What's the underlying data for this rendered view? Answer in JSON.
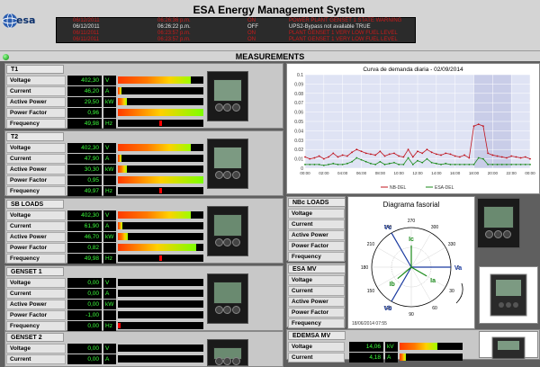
{
  "header": {
    "logo_text": "esa",
    "title": "ESA Energy Management System",
    "alarms": [
      {
        "date": "06/12/2011",
        "time": "06:26:36 p.m.",
        "state": "ON",
        "message": "POWER PLANT GENSET 1 STATE WARNING",
        "color": "#cc1a1a"
      },
      {
        "date": "06/12/2011",
        "time": "06:26:22 p.m.",
        "state": "OFF",
        "message": "UPS2-Bypass not available TRUE",
        "color": "#e8e8e8"
      },
      {
        "date": "06/11/2011",
        "time": "06:23:57 p.m.",
        "state": "ON",
        "message": "PLANT GENSET 1 VERY LOW FUEL LEVEL",
        "color": "#cc1a1a"
      },
      {
        "date": "06/11/2011",
        "time": "06:23:57 p.m.",
        "state": "ON",
        "message": "PLANT GENSET 1 VERY LOW FUEL LEVEL",
        "color": "#cc1a1a"
      }
    ]
  },
  "measurements_title": "MEASUREMENTS",
  "left_panels": [
    {
      "title": "T1",
      "rows": [
        {
          "label": "Voltage",
          "value": "402,30",
          "unit": "V",
          "level": 0.85,
          "marker": null
        },
        {
          "label": "Current",
          "value": "46,20",
          "unit": "A",
          "level": 0.04,
          "marker": null
        },
        {
          "label": "Active Power",
          "value": "29,50",
          "unit": "kW",
          "level": 0.1,
          "marker": null
        },
        {
          "label": "Power Factor",
          "value": "0,96",
          "unit": "",
          "level": 1.0,
          "marker": null
        },
        {
          "label": "Frequency",
          "value": "49,98",
          "unit": "Hz",
          "level": 0,
          "marker": 0.5
        }
      ]
    },
    {
      "title": "T2",
      "rows": [
        {
          "label": "Voltage",
          "value": "402,30",
          "unit": "V",
          "level": 0.85,
          "marker": null
        },
        {
          "label": "Current",
          "value": "47,90",
          "unit": "A",
          "level": 0.04,
          "marker": null
        },
        {
          "label": "Active Power",
          "value": "30,30",
          "unit": "kW",
          "level": 0.1,
          "marker": null
        },
        {
          "label": "Power Factor",
          "value": "0,95",
          "unit": "",
          "level": 1.0,
          "marker": null
        },
        {
          "label": "Frequency",
          "value": "49,97",
          "unit": "Hz",
          "level": 0,
          "marker": 0.5
        }
      ]
    },
    {
      "title": "SB LOADS",
      "rows": [
        {
          "label": "Voltage",
          "value": "402,30",
          "unit": "V",
          "level": 0.85,
          "marker": null
        },
        {
          "label": "Current",
          "value": "61,90",
          "unit": "A",
          "level": 0.05,
          "marker": null
        },
        {
          "label": "Active Power",
          "value": "46,70",
          "unit": "kW",
          "level": 0.12,
          "marker": null
        },
        {
          "label": "Power Factor",
          "value": "0,82",
          "unit": "",
          "level": 0.92,
          "marker": null
        },
        {
          "label": "Frequency",
          "value": "49,98",
          "unit": "Hz",
          "level": 0,
          "marker": 0.5
        }
      ]
    },
    {
      "title": "GENSET 1",
      "rows": [
        {
          "label": "Voltage",
          "value": "0,00",
          "unit": "V",
          "level": 0,
          "marker": null
        },
        {
          "label": "Current",
          "value": "0,00",
          "unit": "A",
          "level": 0,
          "marker": null
        },
        {
          "label": "Active Power",
          "value": "0,00",
          "unit": "kW",
          "level": 0,
          "marker": null
        },
        {
          "label": "Power Factor",
          "value": "-1,00",
          "unit": "",
          "level": 0,
          "marker": null
        },
        {
          "label": "Frequency",
          "value": "0,00",
          "unit": "Hz",
          "level": 0,
          "marker": 0.0
        }
      ]
    },
    {
      "title": "GENSET 2",
      "rows": [
        {
          "label": "Voltage",
          "value": "0,00",
          "unit": "V",
          "level": 0,
          "marker": null
        },
        {
          "label": "Current",
          "value": "0,00",
          "unit": "A",
          "level": 0,
          "marker": null
        }
      ]
    }
  ],
  "right_panels": [
    {
      "title": "NBc LOADS",
      "rows": [
        {
          "label": "Voltage"
        },
        {
          "label": "Current"
        },
        {
          "label": "Active Power"
        },
        {
          "label": "Power Factor"
        },
        {
          "label": "Frequency"
        }
      ]
    },
    {
      "title": "ESA MV",
      "rows": [
        {
          "label": "Voltage"
        },
        {
          "label": "Current"
        },
        {
          "label": "Active Power"
        },
        {
          "label": "Power Factor"
        },
        {
          "label": "Frequency"
        }
      ]
    },
    {
      "title": "EDEMSA MV",
      "rows": [
        {
          "label": "Voltage",
          "value": "14,06",
          "unit": "kV",
          "level": 0.6
        },
        {
          "label": "Current",
          "value": "4,18",
          "unit": "A",
          "level": 0.1
        }
      ]
    }
  ],
  "colors": {
    "led_green": "#3cff3c",
    "alarm_red": "#cc1a1a",
    "panel_bg": "#c8c8c8"
  },
  "chart_data": {
    "type": "line",
    "title": "Curva de demanda diaria - 02/09/2014",
    "x": [
      "00:00",
      "02:00",
      "04:00",
      "06:00",
      "08:00",
      "10:00",
      "12:00",
      "14:00",
      "16:00",
      "18:00",
      "20:00",
      "22:00",
      "00:00"
    ],
    "ytick_labels": [
      "0",
      "0.01",
      "0.02",
      "0.03",
      "0.04",
      "0.05",
      "0.06",
      "0.07",
      "0.08",
      "0.09",
      "0.1"
    ],
    "ylim": [
      0,
      0.1
    ],
    "series": [
      {
        "name": "NB-DEL",
        "color": "#c0141e",
        "values": [
          0.012,
          0.01,
          0.011,
          0.013,
          0.01,
          0.012,
          0.016,
          0.012,
          0.014,
          0.013,
          0.017,
          0.02,
          0.018,
          0.016,
          0.015,
          0.014,
          0.018,
          0.013,
          0.015,
          0.016,
          0.013,
          0.012,
          0.02,
          0.012,
          0.018,
          0.016,
          0.02,
          0.017,
          0.015,
          0.014,
          0.016,
          0.015,
          0.013,
          0.012,
          0.014,
          0.011,
          0.045,
          0.047,
          0.045,
          0.016,
          0.014,
          0.013,
          0.012,
          0.011,
          0.013,
          0.012,
          0.011,
          0.012,
          0.01
        ]
      },
      {
        "name": "ESA-DEL",
        "color": "#1a8a1a",
        "values": [
          0.004,
          0.004,
          0.004,
          0.004,
          0.003,
          0.004,
          0.005,
          0.004,
          0.004,
          0.005,
          0.007,
          0.011,
          0.009,
          0.007,
          0.005,
          0.004,
          0.007,
          0.004,
          0.005,
          0.006,
          0.004,
          0.004,
          0.011,
          0.004,
          0.008,
          0.006,
          0.01,
          0.006,
          0.005,
          0.004,
          0.005,
          0.004,
          0.004,
          0.004,
          0.004,
          0.004,
          0.004,
          0.011,
          0.01,
          0.004,
          0.004,
          0.004,
          0.004,
          0.004,
          0.004,
          0.004,
          0.004,
          0.004,
          0.004
        ]
      }
    ],
    "legend": [
      "NB-DEL",
      "ESA-DEL"
    ],
    "grid": true,
    "legend_position": "bottom"
  },
  "phasor": {
    "title": "Diagrama fasorial",
    "angle_labels": [
      "270",
      "300",
      "330",
      "0",
      "30",
      "60",
      "90",
      "120",
      "150",
      "180",
      "210",
      "240"
    ],
    "vectors": [
      {
        "label": "Va",
        "angle": 0,
        "mag": 1.0,
        "color": "#1a3aa0"
      },
      {
        "label": "Vb",
        "angle": 120,
        "mag": 1.0,
        "color": "#1a3aa0"
      },
      {
        "label": "Vc",
        "angle": 240,
        "mag": 1.0,
        "color": "#1a3aa0"
      },
      {
        "label": "Ia",
        "angle": 30,
        "mag": 0.45,
        "color": "#1a8a1a"
      },
      {
        "label": "Ib",
        "angle": 140,
        "mag": 0.45,
        "color": "#1a8a1a"
      },
      {
        "label": "Ic",
        "angle": 270,
        "mag": 0.55,
        "color": "#1a8a1a"
      }
    ],
    "timestamp": "18/06/2014 07:55"
  }
}
